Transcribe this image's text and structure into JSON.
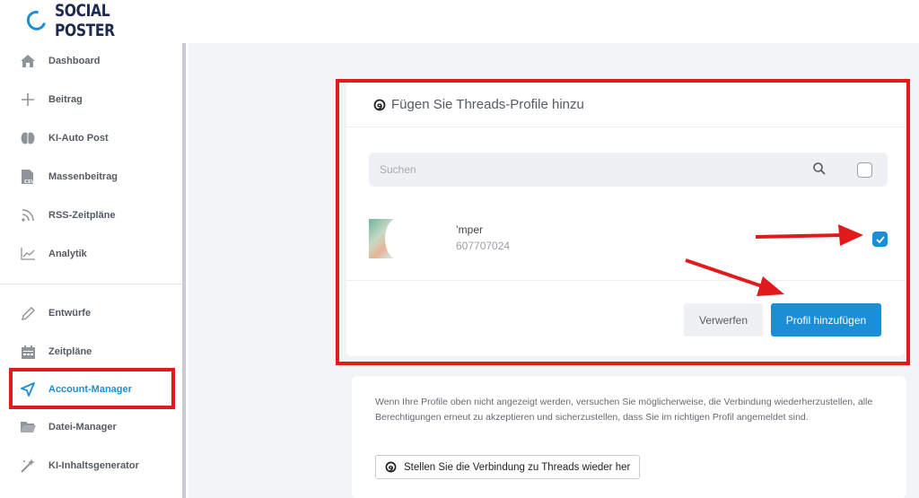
{
  "app": {
    "logo_text": "SOCIAL POSTER",
    "brand_color": "#1a8fd6"
  },
  "sidebar": {
    "items": [
      {
        "label": "Dashboard",
        "icon": "home-icon"
      },
      {
        "label": "Beitrag",
        "icon": "plus-icon"
      },
      {
        "label": "KI-Auto Post",
        "icon": "brain-icon"
      },
      {
        "label": "Massenbeitrag",
        "icon": "csv-file-icon"
      },
      {
        "label": "RSS-Zeitpläne",
        "icon": "rss-icon"
      },
      {
        "label": "Analytik",
        "icon": "line-chart-icon"
      },
      {
        "label": "Entwürfe",
        "icon": "pencil-icon"
      },
      {
        "label": "Zeitpläne",
        "icon": "calendar-icon"
      },
      {
        "label": "Account-Manager",
        "icon": "send-icon",
        "active": true
      },
      {
        "label": "Datei-Manager",
        "icon": "folder-icon"
      },
      {
        "label": "KI-Inhaltsgenerator",
        "icon": "magic-wand-icon"
      }
    ]
  },
  "modal": {
    "title": "Fügen Sie Threads-Profile hinzu",
    "title_icon": "threads-icon",
    "search_placeholder": "Suchen",
    "select_all_checked": false,
    "profiles": [
      {
        "name": "’mper",
        "id": "607707024",
        "checked": true
      }
    ],
    "cancel_label": "Verwerfen",
    "add_label": "Profil hinzufügen"
  },
  "info": {
    "text": "Wenn Ihre Profile oben nicht angezeigt werden, versuchen Sie möglicherweise, die Verbindung wiederherzustellen, alle Berechtigungen erneut zu akzeptieren und sicherzustellen, dass Sie im richtigen Profil angemeldet sind.",
    "reconnect_label": "Stellen Sie die Verbindung zu Threads wieder her"
  },
  "annotation_color": "#e11b1b"
}
